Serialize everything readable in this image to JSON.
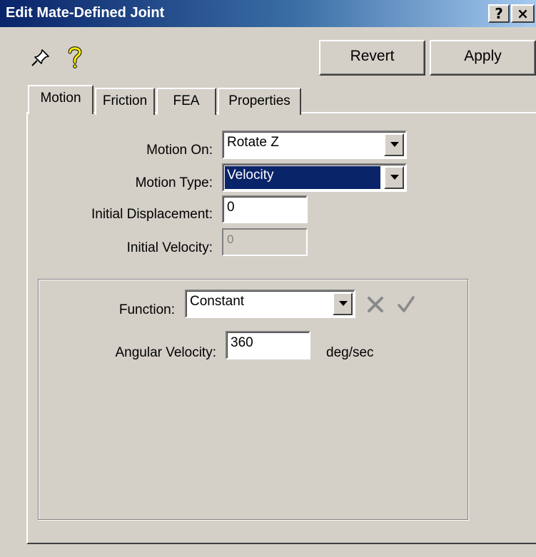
{
  "window": {
    "title": "Edit Mate-Defined Joint",
    "help_glyph": "?",
    "close_glyph": "×"
  },
  "toolbar": {
    "pin_icon": "pushpin-icon",
    "help_icon": "question-mark-icon",
    "revert_label": "Revert",
    "apply_label": "Apply"
  },
  "tabs": [
    {
      "label": "Motion",
      "selected": true
    },
    {
      "label": "Friction",
      "selected": false
    },
    {
      "label": "FEA",
      "selected": false
    },
    {
      "label": "Properties",
      "selected": false
    }
  ],
  "motion": {
    "motion_on_label": "Motion On:",
    "motion_on_value": "Rotate Z",
    "motion_type_label": "Motion Type:",
    "motion_type_value": "Velocity",
    "initial_displacement_label": "Initial Displacement:",
    "initial_displacement_value": "0",
    "initial_velocity_label": "Initial Velocity:",
    "initial_velocity_value": "0"
  },
  "function_group": {
    "function_label": "Function:",
    "function_value": "Constant",
    "angular_velocity_label": "Angular Velocity:",
    "angular_velocity_value": "360",
    "angular_velocity_unit": "deg/sec"
  },
  "colors": {
    "selection": "#0a246a",
    "help_icon_yellow": "#ffee00",
    "disabled_text": "#808080"
  }
}
